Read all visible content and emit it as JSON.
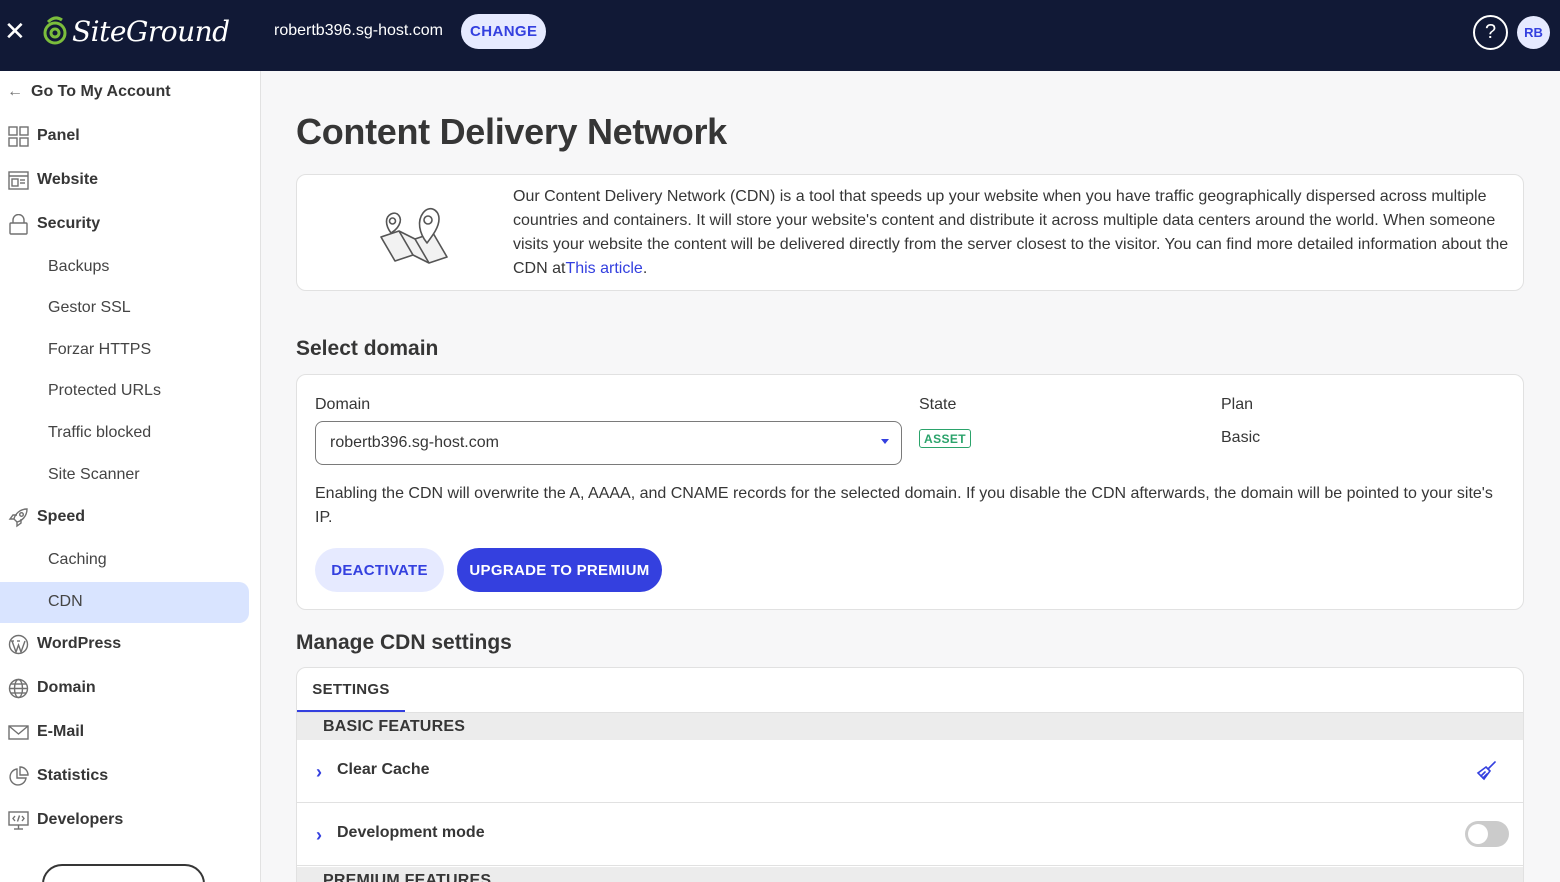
{
  "topbar": {
    "logo_text": "SiteGround",
    "site_name": "robertb396.sg-host.com",
    "change_label": "CHANGE",
    "help_label": "?",
    "avatar_initials": "RB"
  },
  "sidebar": {
    "back_label": "Go To My Account",
    "items": [
      {
        "label": "Panel",
        "icon": "grid-icon"
      },
      {
        "label": "Website",
        "icon": "website-icon"
      },
      {
        "label": "Security",
        "icon": "lock-icon"
      },
      {
        "label": "Backups"
      },
      {
        "label": "Gestor SSL"
      },
      {
        "label": "Forzar HTTPS"
      },
      {
        "label": "Protected URLs"
      },
      {
        "label": "Traffic blocked"
      },
      {
        "label": "Site Scanner"
      },
      {
        "label": "Speed",
        "icon": "rocket-icon"
      },
      {
        "label": "Caching"
      },
      {
        "label": "CDN",
        "active": true
      },
      {
        "label": "WordPress",
        "icon": "wordpress-icon"
      },
      {
        "label": "Domain",
        "icon": "globe-icon"
      },
      {
        "label": "E-Mail",
        "icon": "mail-icon"
      },
      {
        "label": "Statistics",
        "icon": "pie-chart-icon"
      },
      {
        "label": "Developers",
        "icon": "code-icon"
      }
    ]
  },
  "main": {
    "title": "Content Delivery Network",
    "intro": {
      "text": "Our Content Delivery Network (CDN) is a tool that speeds up your website when you have traffic geographically dispersed across multiple countries and containers. It will store your website's content and distribute it across multiple data centers around the world. When someone visits your website the content will be delivered directly from the server closest to the visitor. You can find more detailed information about the CDN at",
      "link_text": "This article",
      "suffix": "."
    },
    "select_domain_title": "Select domain",
    "domain": {
      "domain_label": "Domain",
      "state_label": "State",
      "plan_label": "Plan",
      "selected_domain": "robertb396.sg-host.com",
      "state_value": "ASSET",
      "plan_value": "Basic",
      "notice": "Enabling the CDN will overwrite the A, AAAA, and CNAME records for the selected domain. If you disable the CDN afterwards, the domain will be pointed to your site's IP.",
      "deactivate_label": "DEACTIVATE",
      "upgrade_label": "UPGRADE TO PREMIUM"
    },
    "manage_title": "Manage CDN settings",
    "settings": {
      "tab_label": "SETTINGS",
      "basic_header": "BASIC FEATURES",
      "rows": [
        {
          "label": "Clear Cache"
        },
        {
          "label": "Development mode",
          "enabled": false
        }
      ],
      "premium_header": "PREMIUM FEATURES"
    }
  },
  "colors": {
    "topbar_bg": "#111936",
    "accent": "#3440df",
    "active_bg": "#d9e4ff",
    "state_green": "#2ba36b"
  }
}
